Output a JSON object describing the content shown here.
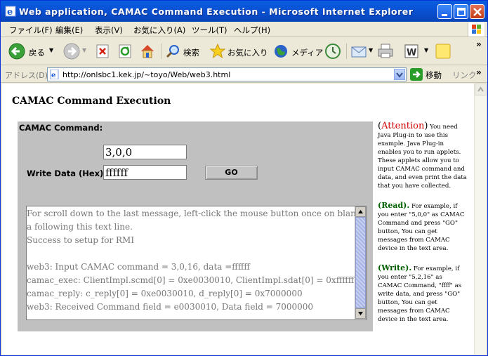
{
  "window": {
    "title": "Web application, CAMAC Command Execution - Microsoft Internet Explorer"
  },
  "menu": [
    "ファイル(F)",
    "編集(E)",
    "表示(V)",
    "お気に入り(A)",
    "ツール(T)",
    "ヘルプ(H)"
  ],
  "toolbar": {
    "back_label": "戻る",
    "search_label": "検索",
    "favorites_label": "お気に入り",
    "media_label": "メディア"
  },
  "addressbar": {
    "label": "アドレス(D)",
    "url": "http://onlsbc1.kek.jp/~toyo/Web/web3.html",
    "go_label": "移動",
    "links_label": "リンク"
  },
  "page": {
    "title": "CAMAC Command Execution",
    "applet": {
      "command_label": "CAMAC Command:",
      "command_value": "3,0,0",
      "write_label": "Write Data (Hex) :",
      "write_value": "ffffff",
      "go_button": "GO",
      "log_lines": [
        "For scroll down to the last message, left-click the mouse button once on blank area",
        "a following this text line.",
        "Success to setup for RMI",
        "",
        "web3:  Input CAMAC command = 3,0,16,    data =ffffff",
        "camac_exec: ClientImpl.scmd[0] = 0xe0030010, ClientImpl.sdat[0] = 0xffffff",
        "camac_reply: c_reply[0] = 0xe0030010, d_reply[0] = 0x7000000",
        "web3:  Received Command field = e0030010,    Data field = 7000000"
      ]
    },
    "side": {
      "attention_open": "(",
      "attention_word": "Attention",
      "attention_close": ")",
      "attention_text": "You need Java Plug-in to use this example. Java Plug-in enables you to run applets. These applets allow you to input CAMAC command and data, and even print the data that you have collected.",
      "read_head": "(Read).",
      "read_text": "For example, if you enter \"5,0,0\" as CAMAC Command and press \"GO\" button, You can get messages from CAMAC device in the text area.",
      "write_head": "(Write).",
      "write_text": "For example, if you enter \"5,2,16\" as CAMAC Command, \"ffff\" as write data, and press \"GO\" button, You can get messages from CAMAC device in the text area."
    }
  }
}
